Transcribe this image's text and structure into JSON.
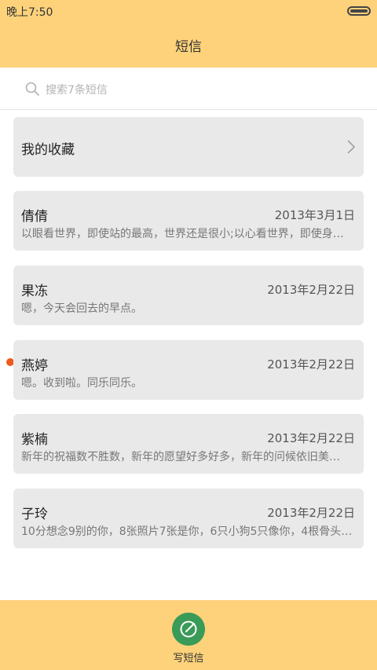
{
  "status_bar": {
    "time": "晚上7:50"
  },
  "header": {
    "title": "短信"
  },
  "search": {
    "placeholder": "搜索7条短信"
  },
  "favorites": {
    "label": "我的收藏"
  },
  "conversations": [
    {
      "name": "倩倩",
      "date": "2013年3月1日",
      "preview": "以眼看世界，即使站的最高，世界还是很小;以心看世界，即使身…",
      "unread": false
    },
    {
      "name": "果冻",
      "date": "2013年2月22日",
      "preview": "嗯，今天会回去的早点。",
      "unread": false
    },
    {
      "name": "燕婷",
      "date": "2013年2月22日",
      "preview": "嗯。收到啦。同乐同乐。",
      "unread": true
    },
    {
      "name": "紫楠",
      "date": "2013年2月22日",
      "preview": "新年的祝福数不胜数，新年的愿望好多好多，新年的问候依旧美…",
      "unread": false
    },
    {
      "name": "子玲",
      "date": "2013年2月22日",
      "preview": "10分想念9别的你，8张照片7张是你，6只小狗5只像你，4根骨头…",
      "unread": false
    }
  ],
  "compose": {
    "label": "写短信"
  },
  "colors": {
    "bar": "#fdd27b",
    "card": "#e9e9e9",
    "unread_dot": "#f05a1e",
    "compose": "#3a9a58"
  }
}
